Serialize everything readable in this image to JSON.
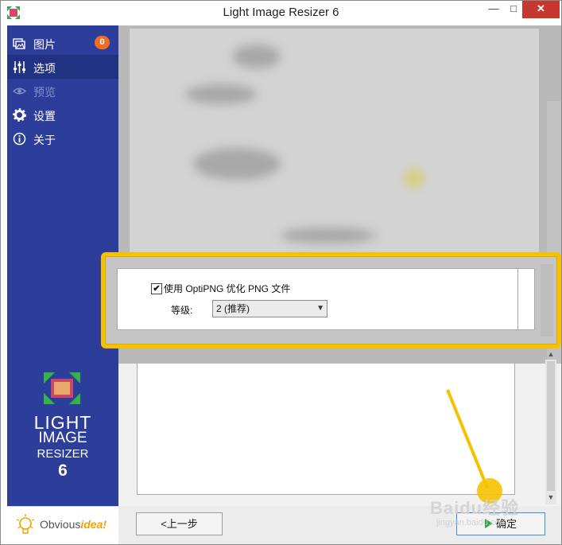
{
  "window": {
    "title": "Light Image Resizer 6",
    "minimize_glyph": "—",
    "maximize_glyph": "□",
    "close_glyph": "✕"
  },
  "sidebar": {
    "items": [
      {
        "label": "图片",
        "icon": "images-icon",
        "badge": "0"
      },
      {
        "label": "选项",
        "icon": "sliders-icon"
      },
      {
        "label": "预览",
        "icon": "eye-icon"
      },
      {
        "label": "设置",
        "icon": "gear-icon"
      },
      {
        "label": "关于",
        "icon": "info-icon"
      }
    ],
    "active_index": 1,
    "logo_lines": [
      "LIGHT",
      "IMAGE",
      "RESIZER",
      "6"
    ],
    "brand": {
      "part1": "Obvious",
      "part2": "idea!"
    }
  },
  "options": {
    "optipng_checked": true,
    "optipng_checkbox_glyph": "✔",
    "optipng_label": "使用 OptiPNG 优化 PNG 文件",
    "level_label": "等级:",
    "level_value": "2 (推荐)"
  },
  "footer": {
    "back_label": "<上一步",
    "ok_label": "确定"
  },
  "scrollbar": {
    "up_glyph": "▲",
    "down_glyph": "▼"
  },
  "watermark": {
    "text": "Baidu经验",
    "sub": "jingyan.baidu.com"
  },
  "colors": {
    "sidebar": "#2d3e9a",
    "sidebar_active": "#223282",
    "badge": "#f26c21",
    "highlight": "#f6c200",
    "close_button": "#c7372f",
    "ok_icon": "#2ea843"
  }
}
